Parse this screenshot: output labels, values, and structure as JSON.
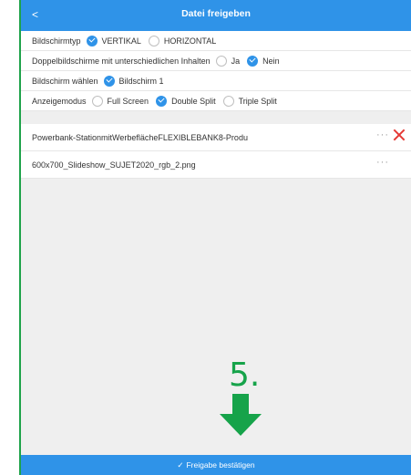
{
  "header": {
    "back_label": "<",
    "title": "Datei freigeben"
  },
  "settings": {
    "screen_type": {
      "label": "Bildschirmtyp",
      "options": [
        "VERTIKAL",
        "HORIZONTAL"
      ],
      "selected": "VERTIKAL"
    },
    "dual_screen": {
      "label": "Doppelbildschirme mit unterschiedlichen Inhalten",
      "options": [
        "Ja",
        "Nein"
      ],
      "selected": "Nein"
    },
    "select_screen": {
      "label": "Bildschirm wählen",
      "options": [
        "Bildschirm 1"
      ],
      "selected": "Bildschirm 1"
    },
    "display_mode": {
      "label": "Anzeigemodus",
      "options": [
        "Full Screen",
        "Double Split",
        "Triple Split"
      ],
      "selected": "Double Split"
    }
  },
  "files": [
    {
      "name": "Powerbank-StationmitWerbeflächeFLEXIBLEBANK8-Produ",
      "more": "···"
    },
    {
      "name": "600x700_Slideshow_SUJET2020_rgb_2.png",
      "more": "···"
    }
  ],
  "annotation": {
    "step": "5."
  },
  "footer": {
    "confirm_label": "Freigabe bestätigen",
    "confirm_icon": "✓"
  },
  "colors": {
    "primary": "#2f93e8",
    "annotation": "#16a34a",
    "delete": "#e53935"
  }
}
